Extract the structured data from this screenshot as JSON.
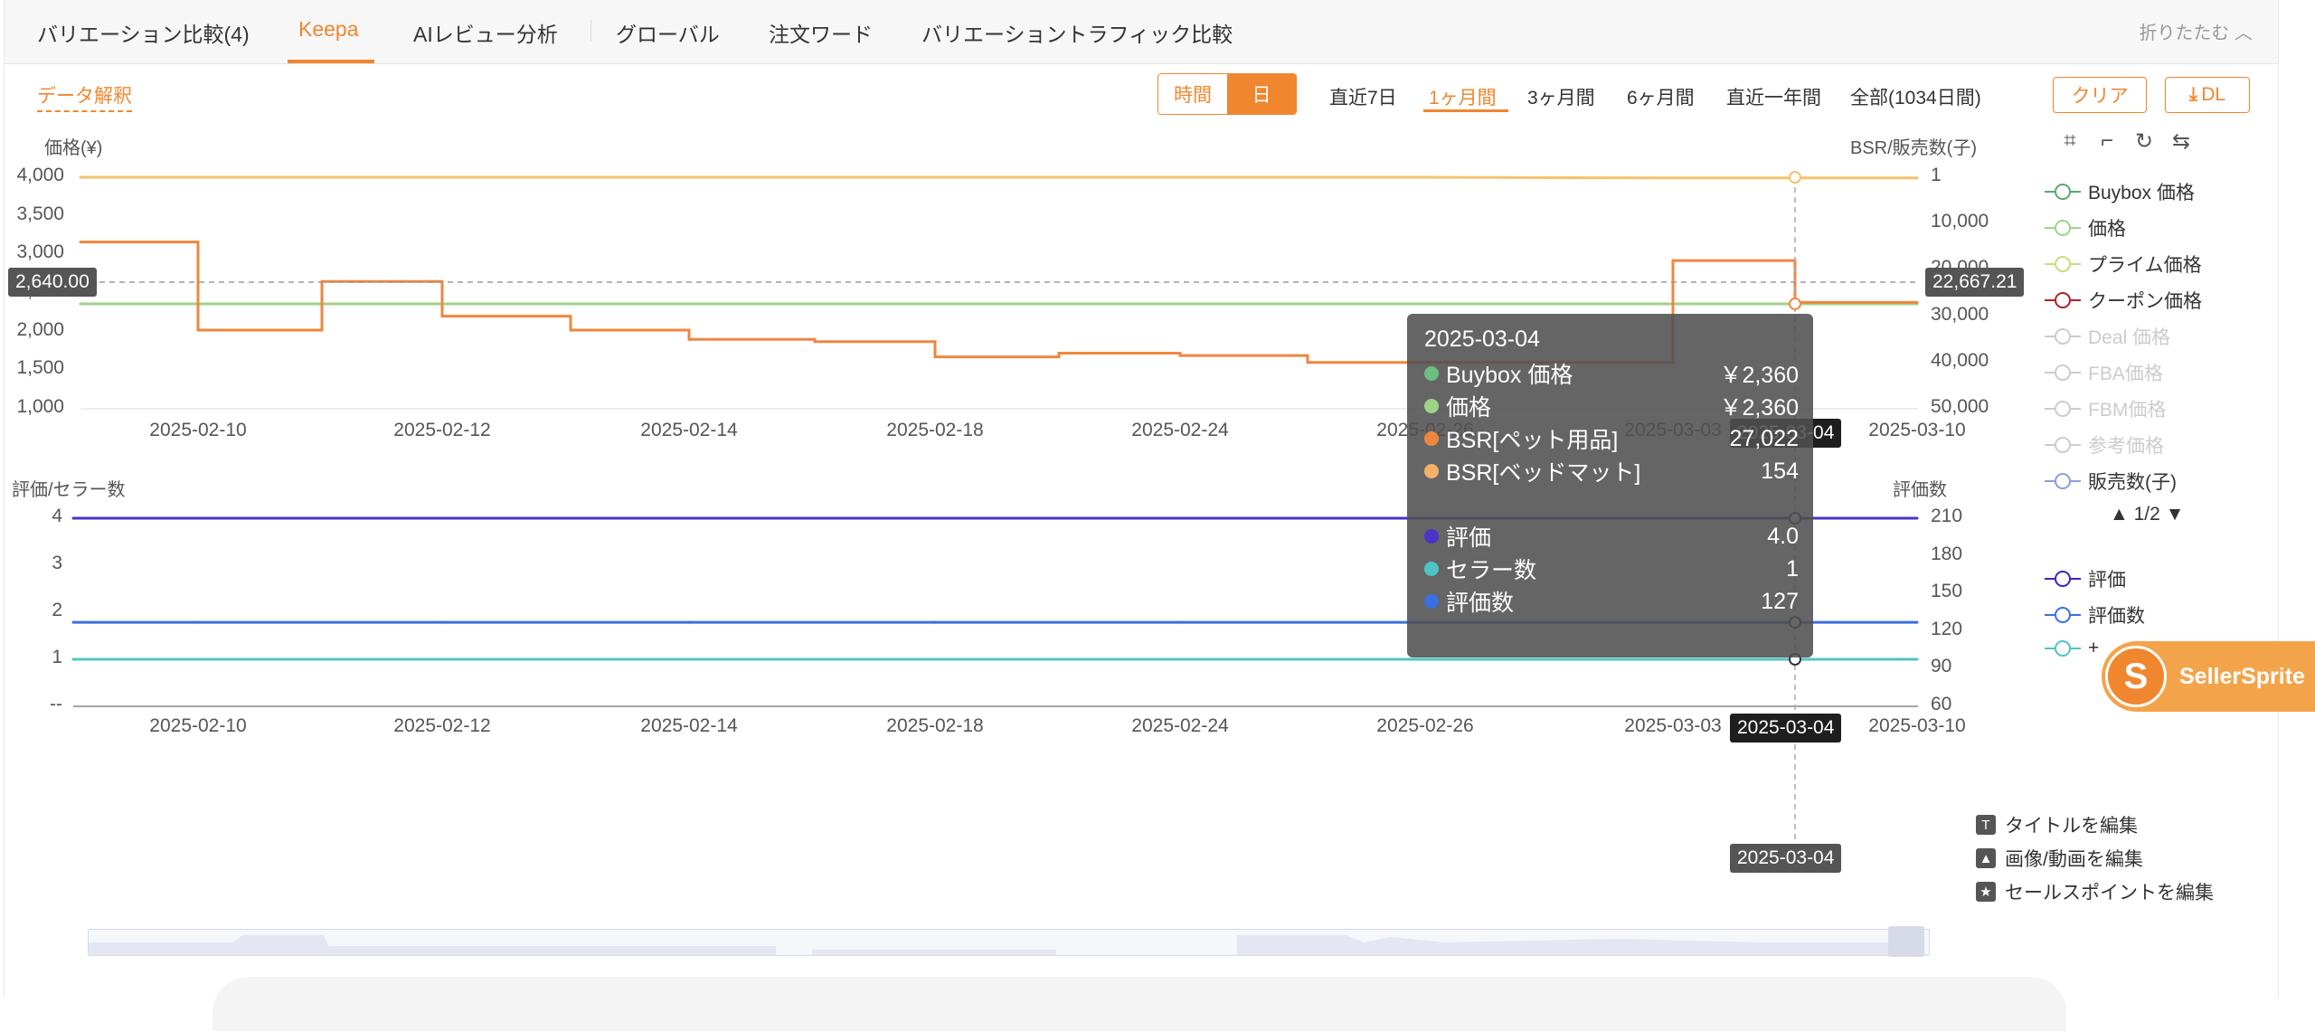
{
  "tabs": [
    {
      "label": "バリエーション比較(4)",
      "active": false
    },
    {
      "label": "Keepa",
      "active": true
    },
    {
      "label": "AIレビュー分析",
      "active": false
    },
    {
      "label": "グローバル",
      "active": false
    },
    {
      "label": "注文ワード",
      "active": false
    },
    {
      "label": "バリエーショントラフィック比較",
      "active": false
    }
  ],
  "collapse_label": "折りたたむ ︿",
  "toolbar": {
    "data_link": "データ解釈",
    "mode": {
      "time": "時間",
      "day": "日"
    },
    "ranges": [
      "直近7日",
      "1ヶ月間",
      "3ヶ月間",
      "6ヶ月間",
      "直近一年間",
      "全部(1034日間)"
    ],
    "active_range": "1ヶ月間",
    "clear": "クリア",
    "dl": "DL",
    "dl_icon": "download-icon",
    "icons": [
      "zoom-select-icon",
      "zoom-reset-icon",
      "restore-icon",
      "swap-icon"
    ]
  },
  "top_chart": {
    "left_axis_title": "価格(¥)",
    "right_axis_title": "BSR/販売数(子)",
    "left_ticks": [
      "4,000",
      "3,500",
      "3,000",
      "2,500",
      "2,000",
      "1,500",
      "1,000"
    ],
    "right_ticks": [
      "1",
      "10,000",
      "20,000",
      "30,000",
      "40,000",
      "50,000"
    ],
    "dates": [
      "2025-02-10",
      "2025-02-12",
      "2025-02-14",
      "2025-02-18",
      "2025-02-24",
      "2025-02-26",
      "2025-03-03",
      "2025-03-10"
    ],
    "left_pointer": "2,640.00",
    "right_pointer": "22,667.21",
    "date_pointer": "2025-03-04"
  },
  "bottom_chart": {
    "left_axis_title": "評価/セラー数",
    "right_axis_title": "評価数",
    "left_ticks": [
      "4",
      "3",
      "2",
      "1",
      "--"
    ],
    "right_ticks": [
      "210",
      "180",
      "150",
      "120",
      "90",
      "60"
    ],
    "dates": [
      "2025-02-10",
      "2025-02-12",
      "2025-02-14",
      "2025-02-18",
      "2025-02-24",
      "2025-02-26",
      "2025-03-03",
      "2025-03-10"
    ],
    "date_pointer": "2025-03-04"
  },
  "footer_date_pointer": "2025-03-04",
  "tooltip": {
    "date": "2025-03-04",
    "rows": [
      {
        "label": "Buybox 価格",
        "value": "￥2,360",
        "color": "#6dbd7c"
      },
      {
        "label": "価格",
        "value": "￥2,360",
        "color": "#9ed38a"
      },
      {
        "label": "BSR[ペット用品]",
        "value": "27,022",
        "color": "#f0863e"
      },
      {
        "label": "BSR[ベッドマット]",
        "value": "154",
        "color": "#f5b16a"
      },
      {
        "label": "評価",
        "value": "4.0",
        "color": "#4b32c8"
      },
      {
        "label": "セラー数",
        "value": "1",
        "color": "#4fc4c4"
      },
      {
        "label": "評価数",
        "value": "127",
        "color": "#3b6fe0"
      }
    ]
  },
  "legend_top": [
    {
      "label": "Buybox 価格",
      "color": "#5aa86a",
      "dim": false
    },
    {
      "label": "価格",
      "color": "#9ed38a",
      "dim": false
    },
    {
      "label": "プライム価格",
      "color": "#c9de7a",
      "dim": false
    },
    {
      "label": "クーポン価格",
      "color": "#b0202a",
      "dim": false
    },
    {
      "label": "Deal 価格",
      "color": "#cccccc",
      "dim": true
    },
    {
      "label": "FBA価格",
      "color": "#cccccc",
      "dim": true
    },
    {
      "label": "FBM価格",
      "color": "#cccccc",
      "dim": true
    },
    {
      "label": "参考価格",
      "color": "#cccccc",
      "dim": true
    },
    {
      "label": "販売数(子)",
      "color": "#8f9be0",
      "dim": false
    }
  ],
  "legend_pager": "▲ 1/2 ▼",
  "legend_bottom": [
    {
      "label": "評価",
      "color": "#3a22c8",
      "dim": false
    },
    {
      "label": "評価数",
      "color": "#3b6fe0",
      "dim": false
    },
    {
      "label": "+",
      "color": "#4fc4c4",
      "dim": false
    }
  ],
  "edit_menu": [
    {
      "label": "タイトルを編集",
      "icon": "text-icon"
    },
    {
      "label": "画像/動画を編集",
      "icon": "image-icon"
    },
    {
      "label": "セールスポイントを編集",
      "icon": "star-icon"
    }
  ],
  "badge": "SellerSprite",
  "chart_data": [
    {
      "type": "line",
      "title": "",
      "xlabel": "",
      "ylabel": "価格(¥)",
      "ylabel_right": "BSR/販売数(子)",
      "ylim": [
        1000,
        4000
      ],
      "ylim_right": [
        1,
        50000
      ],
      "right_axis_inverted": true,
      "x": [
        "2025-02-09",
        "2025-02-10",
        "2025-02-11",
        "2025-02-12",
        "2025-02-13",
        "2025-02-14",
        "2025-02-16",
        "2025-02-18",
        "2025-02-20",
        "2025-02-24",
        "2025-02-25",
        "2025-02-26",
        "2025-03-03",
        "2025-03-04",
        "2025-03-10"
      ],
      "series": [
        {
          "name": "Buybox 価格",
          "axis": "left",
          "color": "#6dbd7c",
          "values": [
            2360,
            2360,
            2360,
            2360,
            2360,
            2360,
            2360,
            2360,
            2360,
            2360,
            2360,
            2360,
            2360,
            2360,
            2360
          ]
        },
        {
          "name": "価格",
          "axis": "left",
          "color": "#9ed38a",
          "values": [
            2360,
            2360,
            2360,
            2360,
            2360,
            2360,
            2360,
            2360,
            2360,
            2360,
            2360,
            2360,
            2360,
            2360,
            2360
          ]
        },
        {
          "name": "BSR[ベッドマット]",
          "axis": "right",
          "color": "#f5c26a",
          "values": [
            1,
            1,
            1,
            1,
            1,
            1,
            1,
            1,
            1,
            1,
            1,
            1,
            154,
            154,
            154
          ]
        },
        {
          "name": "BSR[ペット用品]",
          "axis": "right",
          "color": "#f0863e",
          "values": [
            14000,
            33000,
            22500,
            30000,
            33000,
            35000,
            35500,
            38800,
            38000,
            38500,
            40000,
            40000,
            18000,
            27022,
            27022
          ]
        }
      ]
    },
    {
      "type": "line",
      "title": "",
      "xlabel": "",
      "ylabel": "評価/セラー数",
      "ylabel_right": "評価数",
      "ylim": [
        0,
        4
      ],
      "ylim_right": [
        60,
        210
      ],
      "x": [
        "2025-02-09",
        "2025-02-10",
        "2025-02-12",
        "2025-02-14",
        "2025-02-18",
        "2025-02-24",
        "2025-02-26",
        "2025-03-03",
        "2025-03-04",
        "2025-03-10"
      ],
      "series": [
        {
          "name": "評価",
          "axis": "left",
          "color": "#4b32c8",
          "values": [
            4,
            4,
            4,
            4,
            4,
            4,
            4,
            4,
            4,
            4
          ]
        },
        {
          "name": "セラー数",
          "axis": "left",
          "color": "#4fc4c4",
          "values": [
            1,
            1,
            1,
            1,
            1,
            1,
            1,
            1,
            1,
            1
          ]
        },
        {
          "name": "評価数",
          "axis": "right",
          "color": "#3b6fe0",
          "values": [
            127,
            127,
            127,
            127,
            127,
            127,
            127,
            127,
            127,
            127
          ]
        }
      ]
    }
  ]
}
